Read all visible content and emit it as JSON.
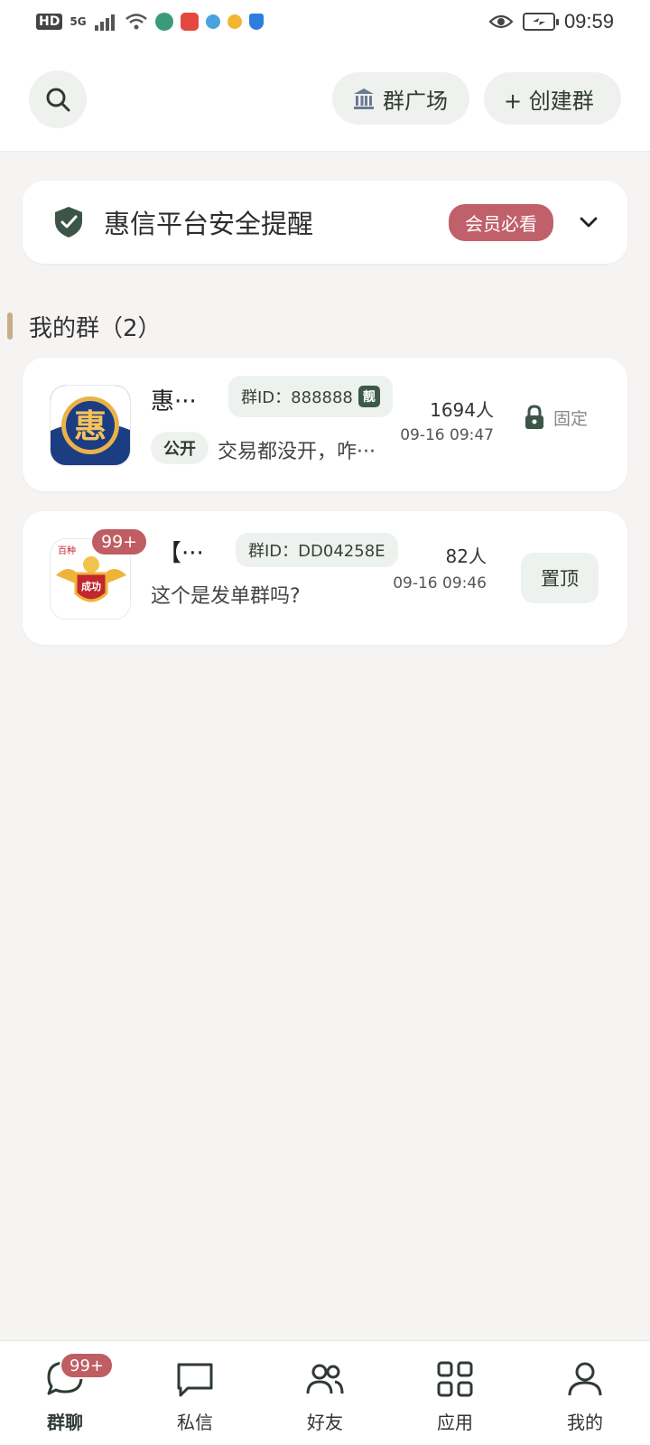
{
  "status_bar": {
    "hd": "HD",
    "network": "5G",
    "time": "09:59"
  },
  "header": {
    "plaza_label": "群广场",
    "create_label": "+ 创建群"
  },
  "safety": {
    "title": "惠信平台安全提醒",
    "badge": "会员必看"
  },
  "section": {
    "title": "我的群（2）"
  },
  "groups": [
    {
      "name": "惠···",
      "gid": "群ID：888888",
      "liang": "靓",
      "tag": "公开",
      "message": "交易都没开，咋···",
      "count": "1694人",
      "time": "09-16 09:47",
      "fixed_label": "固定"
    },
    {
      "name": "【···",
      "gid": "群ID：DD04258E",
      "message": "这个是发单群吗?",
      "count": "82人",
      "time": "09-16 09:46",
      "unread": "99+",
      "pin_label": "置顶"
    }
  ],
  "nav": {
    "items": [
      {
        "label": "群聊",
        "badge": "99+"
      },
      {
        "label": "私信"
      },
      {
        "label": "好友"
      },
      {
        "label": "应用"
      },
      {
        "label": "我的"
      }
    ]
  },
  "colors": {
    "accent_dark": "#2f3a33",
    "badge_red": "#bf5d63",
    "member_badge": "#c0606a"
  }
}
